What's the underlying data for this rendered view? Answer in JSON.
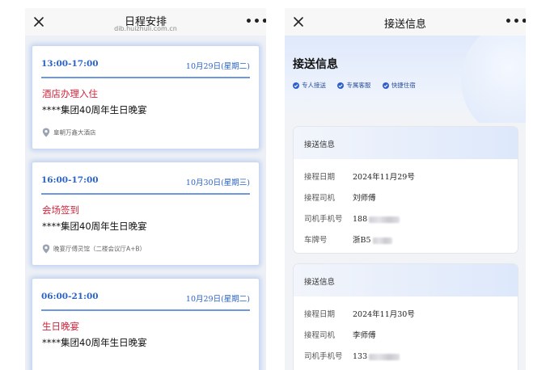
{
  "left_screen": {
    "title": "日程安排",
    "url": "dib.huizhuli.com.cn",
    "more_label": "•••",
    "events": [
      {
        "time": "13:00-17:00",
        "date": "10月29日(星期二)",
        "name": "酒店办理入住",
        "subtitle": "****集团40周年生日晚宴",
        "location": "皇朝万鑫大酒店"
      },
      {
        "time": "16:00-17:00",
        "date": "10月30日(星期三)",
        "name": "会场签到",
        "subtitle": "****集团40周年生日晚宴",
        "location": "晚宴厅傅灵馆（二楼会议厅A+B）"
      },
      {
        "time": "06:00-21:00",
        "date": "10月29日(星期二)",
        "name": "生日晚宴",
        "subtitle": "****集团40周年生日晚宴",
        "location": ""
      }
    ]
  },
  "right_screen": {
    "title": "接送信息",
    "more_label": "•••",
    "hero_title": "接送信息",
    "features": [
      "专人接送",
      "专属客服",
      "快捷住宿"
    ],
    "cards": [
      {
        "header": "接送信息",
        "rows": [
          {
            "label": "接程日期",
            "value": "2024年11月29号"
          },
          {
            "label": "接程司机",
            "value": "刘师傅"
          },
          {
            "label": "司机手机号",
            "value": "188"
          },
          {
            "label": "车牌号",
            "value": "浙B5"
          }
        ]
      },
      {
        "header": "接送信息",
        "rows": [
          {
            "label": "接程日期",
            "value": "2024年11月30号"
          },
          {
            "label": "接程司机",
            "value": "李师傅"
          },
          {
            "label": "司机手机号",
            "value": "133"
          }
        ]
      }
    ]
  },
  "colors": {
    "accent": "#2a63c8",
    "event_red": "#d2233b",
    "divider": "#6e98e0"
  }
}
